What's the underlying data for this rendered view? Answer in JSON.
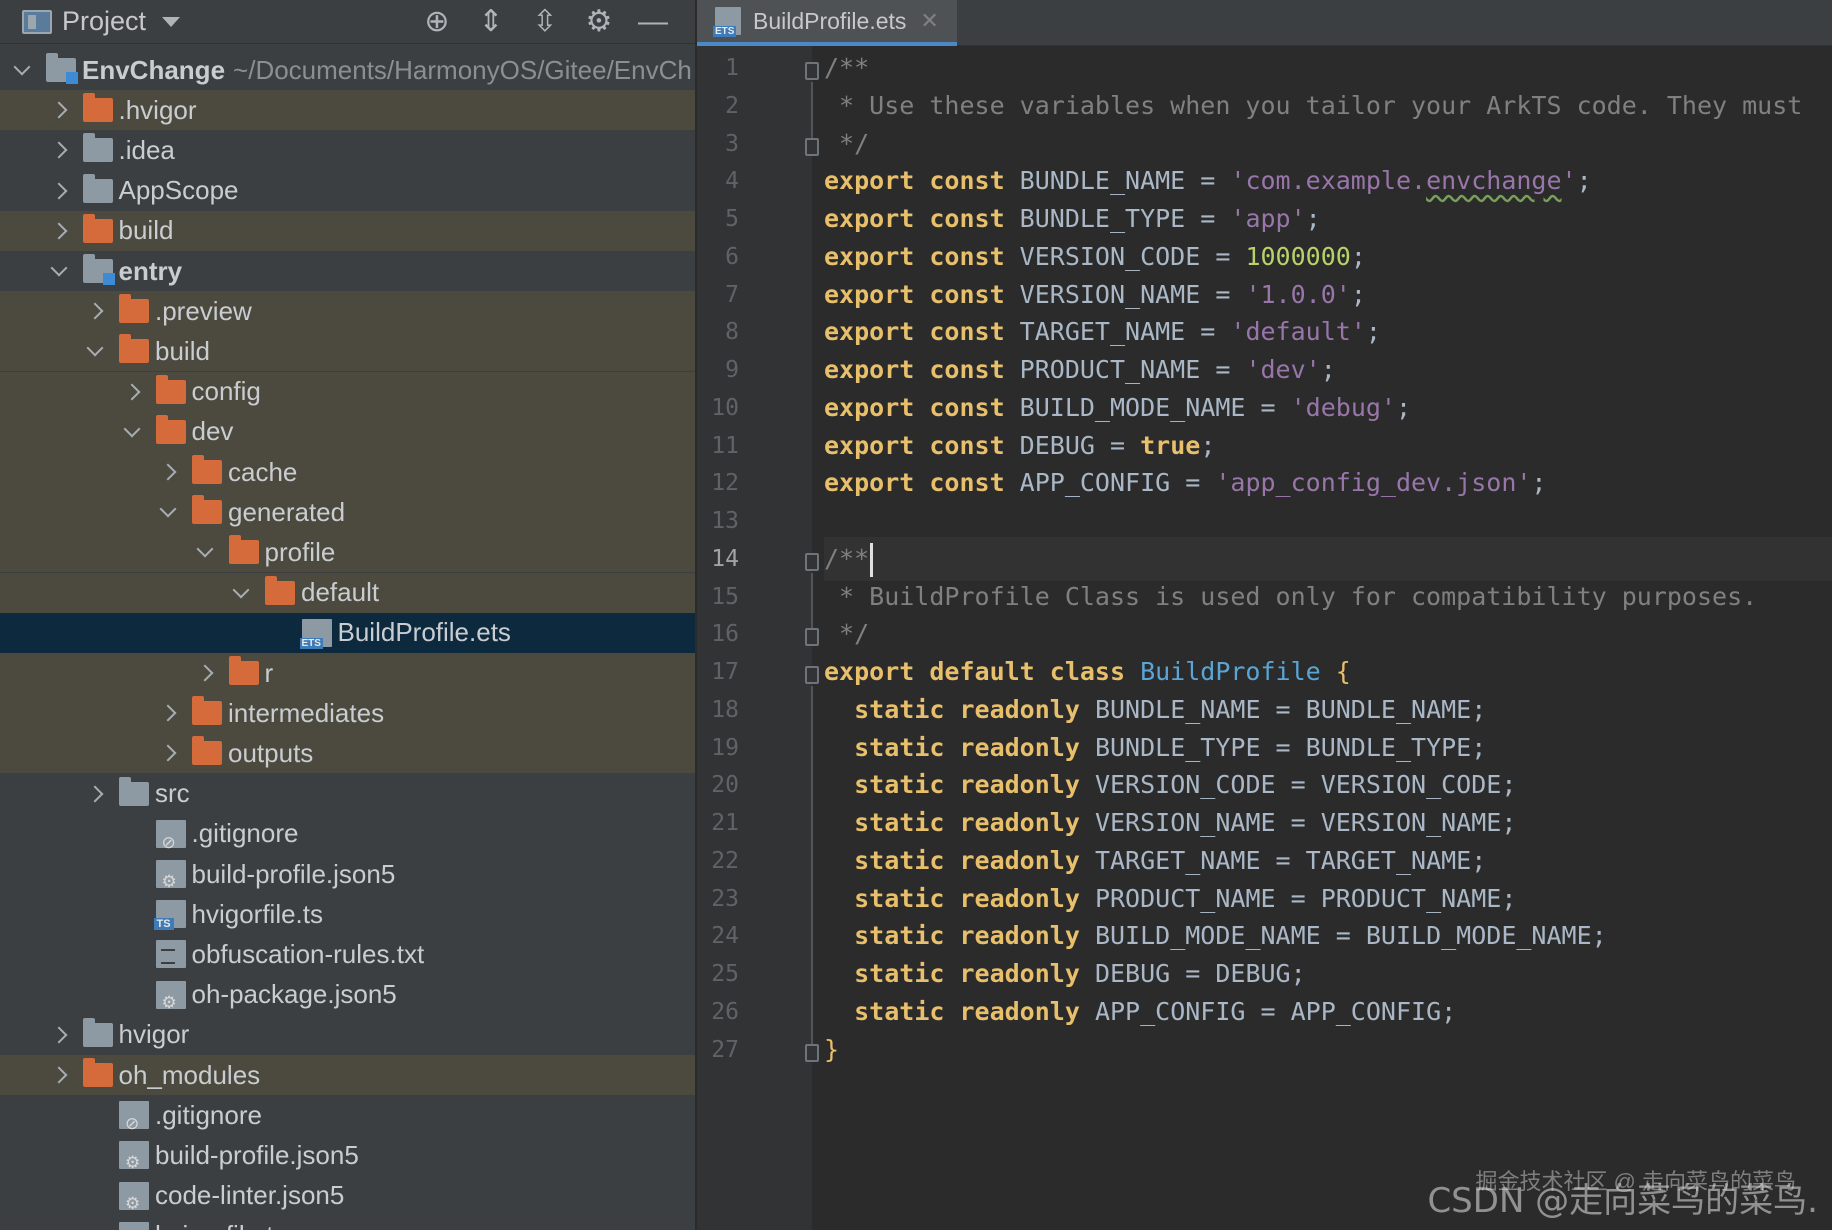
{
  "project_panel": {
    "title": "Project",
    "toolbar_icons": [
      "locate-icon",
      "expand-all-icon",
      "collapse-all-icon",
      "gear-icon",
      "hide-icon"
    ],
    "tree": [
      {
        "label": "EnvChange",
        "path": "~/Documents/HarmonyOS/Gitee/EnvCh",
        "icon": "module-folder",
        "depth": 0,
        "state": "expanded",
        "bold": true
      },
      {
        "label": ".hvigor",
        "icon": "folder-orange",
        "depth": 1,
        "state": "collapsed",
        "excluded": true
      },
      {
        "label": ".idea",
        "icon": "folder-grey",
        "depth": 1,
        "state": "collapsed"
      },
      {
        "label": "AppScope",
        "icon": "folder-grey",
        "depth": 1,
        "state": "collapsed"
      },
      {
        "label": "build",
        "icon": "folder-orange",
        "depth": 1,
        "state": "collapsed",
        "excluded": true
      },
      {
        "label": "entry",
        "icon": "module-folder",
        "depth": 1,
        "state": "expanded",
        "bold": true
      },
      {
        "label": ".preview",
        "icon": "folder-orange",
        "depth": 2,
        "state": "collapsed",
        "excluded": true
      },
      {
        "label": "build",
        "icon": "folder-orange",
        "depth": 2,
        "state": "expanded",
        "excluded": true
      },
      {
        "label": "config",
        "icon": "folder-orange",
        "depth": 3,
        "state": "collapsed",
        "excluded": true
      },
      {
        "label": "dev",
        "icon": "folder-orange",
        "depth": 3,
        "state": "expanded",
        "excluded": true
      },
      {
        "label": "cache",
        "icon": "folder-orange",
        "depth": 4,
        "state": "collapsed",
        "excluded": true
      },
      {
        "label": "generated",
        "icon": "folder-orange",
        "depth": 4,
        "state": "expanded",
        "excluded": true
      },
      {
        "label": "profile",
        "icon": "folder-orange",
        "depth": 5,
        "state": "expanded",
        "excluded": true
      },
      {
        "label": "default",
        "icon": "folder-orange",
        "depth": 6,
        "state": "expanded",
        "excluded": true
      },
      {
        "label": "BuildProfile.ets",
        "icon": "file-ets",
        "depth": 7,
        "state": "leaf",
        "selected": true
      },
      {
        "label": "r",
        "icon": "folder-orange",
        "depth": 5,
        "state": "collapsed",
        "excluded": true
      },
      {
        "label": "intermediates",
        "icon": "folder-orange",
        "depth": 4,
        "state": "collapsed",
        "excluded": true
      },
      {
        "label": "outputs",
        "icon": "folder-orange",
        "depth": 4,
        "state": "collapsed",
        "excluded": true
      },
      {
        "label": "src",
        "icon": "folder-grey",
        "depth": 2,
        "state": "collapsed"
      },
      {
        "label": ".gitignore",
        "icon": "file-ignore",
        "depth": 3,
        "state": "leaf"
      },
      {
        "label": "build-profile.json5",
        "icon": "file-cfg",
        "depth": 3,
        "state": "leaf"
      },
      {
        "label": "hvigorfile.ts",
        "icon": "file-ts",
        "depth": 3,
        "state": "leaf"
      },
      {
        "label": "obfuscation-rules.txt",
        "icon": "file-txt",
        "depth": 3,
        "state": "leaf"
      },
      {
        "label": "oh-package.json5",
        "icon": "file-cfg",
        "depth": 3,
        "state": "leaf"
      },
      {
        "label": "hvigor",
        "icon": "folder-grey",
        "depth": 1,
        "state": "collapsed"
      },
      {
        "label": "oh_modules",
        "icon": "folder-orange",
        "depth": 1,
        "state": "collapsed",
        "excluded": true
      },
      {
        "label": ".gitignore",
        "icon": "file-ignore",
        "depth": 2,
        "state": "leaf"
      },
      {
        "label": "build-profile.json5",
        "icon": "file-cfg",
        "depth": 2,
        "state": "leaf"
      },
      {
        "label": "code-linter.json5",
        "icon": "file-cfg",
        "depth": 2,
        "state": "leaf"
      },
      {
        "label": "hvigorfile.ts",
        "icon": "file-ts",
        "depth": 2,
        "state": "leaf"
      }
    ]
  },
  "editor": {
    "tab_label": "BuildProfile.ets",
    "current_line": 14,
    "lines": [
      {
        "n": "1",
        "fold": true,
        "tokens": [
          [
            "cmt",
            "/**"
          ]
        ]
      },
      {
        "n": "2",
        "tokens": [
          [
            "cmt",
            " * Use these variables when you tailor your ArkTS code. They must"
          ]
        ]
      },
      {
        "n": "3",
        "fold": true,
        "tokens": [
          [
            "cmt",
            " */"
          ]
        ]
      },
      {
        "n": "4",
        "tokens": [
          [
            "kwy",
            "export const "
          ],
          [
            "ident",
            "BUNDLE_NAME = "
          ],
          [
            "str",
            "'com.example."
          ],
          [
            "str squig",
            "envchange"
          ],
          [
            "str",
            "'"
          ],
          [
            "ident",
            ";"
          ]
        ]
      },
      {
        "n": "5",
        "tokens": [
          [
            "kwy",
            "export const "
          ],
          [
            "ident",
            "BUNDLE_TYPE = "
          ],
          [
            "str",
            "'app'"
          ],
          [
            "ident",
            ";"
          ]
        ]
      },
      {
        "n": "6",
        "tokens": [
          [
            "kwy",
            "export const "
          ],
          [
            "ident",
            "VERSION_CODE = "
          ],
          [
            "numg",
            "1000000"
          ],
          [
            "ident",
            ";"
          ]
        ]
      },
      {
        "n": "7",
        "tokens": [
          [
            "kwy",
            "export const "
          ],
          [
            "ident",
            "VERSION_NAME = "
          ],
          [
            "str",
            "'1.0.0'"
          ],
          [
            "ident",
            ";"
          ]
        ]
      },
      {
        "n": "8",
        "tokens": [
          [
            "kwy",
            "export const "
          ],
          [
            "ident",
            "TARGET_NAME = "
          ],
          [
            "str",
            "'default'"
          ],
          [
            "ident",
            ";"
          ]
        ]
      },
      {
        "n": "9",
        "tokens": [
          [
            "kwy",
            "export const "
          ],
          [
            "ident",
            "PRODUCT_NAME = "
          ],
          [
            "str",
            "'dev'"
          ],
          [
            "ident",
            ";"
          ]
        ]
      },
      {
        "n": "10",
        "tokens": [
          [
            "kwy",
            "export const "
          ],
          [
            "ident",
            "BUILD_MODE_NAME = "
          ],
          [
            "str",
            "'debug'"
          ],
          [
            "ident",
            ";"
          ]
        ]
      },
      {
        "n": "11",
        "tokens": [
          [
            "kwy",
            "export const "
          ],
          [
            "ident",
            "DEBUG = "
          ],
          [
            "kwy",
            "true"
          ],
          [
            "ident",
            ";"
          ]
        ]
      },
      {
        "n": "12",
        "tokens": [
          [
            "kwy",
            "export const "
          ],
          [
            "ident",
            "APP_CONFIG = "
          ],
          [
            "str",
            "'app_config_dev.json'"
          ],
          [
            "ident",
            ";"
          ]
        ]
      },
      {
        "n": "13",
        "tokens": []
      },
      {
        "n": "14",
        "fold": true,
        "caret": true,
        "tokens": [
          [
            "cmt",
            "/**"
          ]
        ]
      },
      {
        "n": "15",
        "tokens": [
          [
            "cmt",
            " * BuildProfile Class is used only for compatibility purposes."
          ]
        ]
      },
      {
        "n": "16",
        "fold": true,
        "tokens": [
          [
            "cmt",
            " */"
          ]
        ]
      },
      {
        "n": "17",
        "fold": true,
        "tokens": [
          [
            "kwy",
            "export default class "
          ],
          [
            "cls",
            "BuildProfile "
          ],
          [
            "brace",
            "{"
          ]
        ]
      },
      {
        "n": "18",
        "tokens": [
          [
            "ident",
            "  "
          ],
          [
            "kwy",
            "static readonly "
          ],
          [
            "ident",
            "BUNDLE_NAME = BUNDLE_NAME;"
          ]
        ]
      },
      {
        "n": "19",
        "tokens": [
          [
            "ident",
            "  "
          ],
          [
            "kwy",
            "static readonly "
          ],
          [
            "ident",
            "BUNDLE_TYPE = BUNDLE_TYPE;"
          ]
        ]
      },
      {
        "n": "20",
        "tokens": [
          [
            "ident",
            "  "
          ],
          [
            "kwy",
            "static readonly "
          ],
          [
            "ident",
            "VERSION_CODE = VERSION_CODE;"
          ]
        ]
      },
      {
        "n": "21",
        "tokens": [
          [
            "ident",
            "  "
          ],
          [
            "kwy",
            "static readonly "
          ],
          [
            "ident",
            "VERSION_NAME = VERSION_NAME;"
          ]
        ]
      },
      {
        "n": "22",
        "tokens": [
          [
            "ident",
            "  "
          ],
          [
            "kwy",
            "static readonly "
          ],
          [
            "ident",
            "TARGET_NAME = TARGET_NAME;"
          ]
        ]
      },
      {
        "n": "23",
        "tokens": [
          [
            "ident",
            "  "
          ],
          [
            "kwy",
            "static readonly "
          ],
          [
            "ident",
            "PRODUCT_NAME = PRODUCT_NAME;"
          ]
        ]
      },
      {
        "n": "24",
        "tokens": [
          [
            "ident",
            "  "
          ],
          [
            "kwy",
            "static readonly "
          ],
          [
            "ident",
            "BUILD_MODE_NAME = BUILD_MODE_NAME;"
          ]
        ]
      },
      {
        "n": "25",
        "tokens": [
          [
            "ident",
            "  "
          ],
          [
            "kwy",
            "static readonly "
          ],
          [
            "ident",
            "DEBUG = DEBUG;"
          ]
        ]
      },
      {
        "n": "26",
        "tokens": [
          [
            "ident",
            "  "
          ],
          [
            "kwy",
            "static readonly "
          ],
          [
            "ident",
            "APP_CONFIG = APP_CONFIG;"
          ]
        ]
      },
      {
        "n": "27",
        "fold": true,
        "tokens": [
          [
            "brace",
            "}"
          ]
        ]
      }
    ]
  },
  "watermark": {
    "line1": "掘金技术社区 @ 走向菜鸟的菜鸟",
    "line2": "CSDN @走向菜鸟的菜鸟."
  },
  "colors": {
    "panel_bg": "#3c3f41",
    "editor_bg": "#2b2b2b",
    "selection": "#0d293e",
    "excluded_bg": "#4c4a3e",
    "keyword": "#e8bf6a",
    "string": "#9876aa",
    "number": "#b8d26a",
    "comment": "#808080",
    "class_name": "#5aa5d6",
    "tab_underline": "#4a88c7"
  }
}
